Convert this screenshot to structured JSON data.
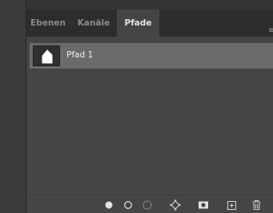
{
  "tabs": [
    {
      "label": "Ebenen",
      "active": false
    },
    {
      "label": "Kanäle",
      "active": false
    },
    {
      "label": "Pfade",
      "active": true
    }
  ],
  "paths": [
    {
      "name": "Pfad 1",
      "selected": true
    }
  ],
  "footer_buttons": [
    "fill-path-icon",
    "stroke-path-icon",
    "load-as-selection-icon",
    "make-work-path-icon",
    "add-mask-icon",
    "new-path-icon",
    "delete-path-icon"
  ],
  "colors": {
    "panel_bg": "#454545",
    "tab_bar": "#2d2d2d",
    "selected_row": "#6b6b6b"
  }
}
